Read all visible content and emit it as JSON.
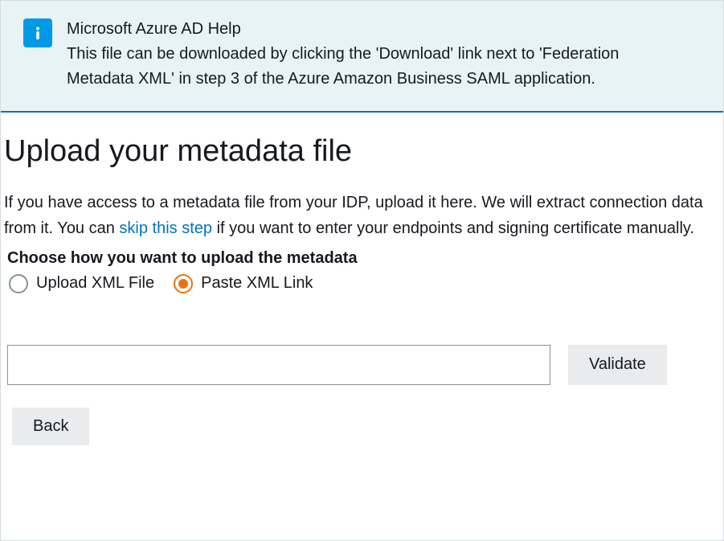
{
  "info": {
    "title": "Microsoft Azure AD Help",
    "body": "This file can be downloaded by clicking the 'Download' link next to 'Federation Metadata XML' in step 3 of the Azure Amazon Business SAML application."
  },
  "page": {
    "title": "Upload your metadata file",
    "intro_before": "If you have access to a metadata file from your IDP, upload it here. We will extract connection data from it. You can ",
    "skip_link": "skip this step",
    "intro_after": " if you want to enter your endpoints and signing certificate manually.",
    "choose_label": "Choose how you want to upload the metadata"
  },
  "radios": {
    "upload_label": "Upload XML File",
    "paste_label": "Paste XML Link",
    "selected": "paste"
  },
  "input": {
    "value": ""
  },
  "buttons": {
    "validate": "Validate",
    "back": "Back"
  }
}
